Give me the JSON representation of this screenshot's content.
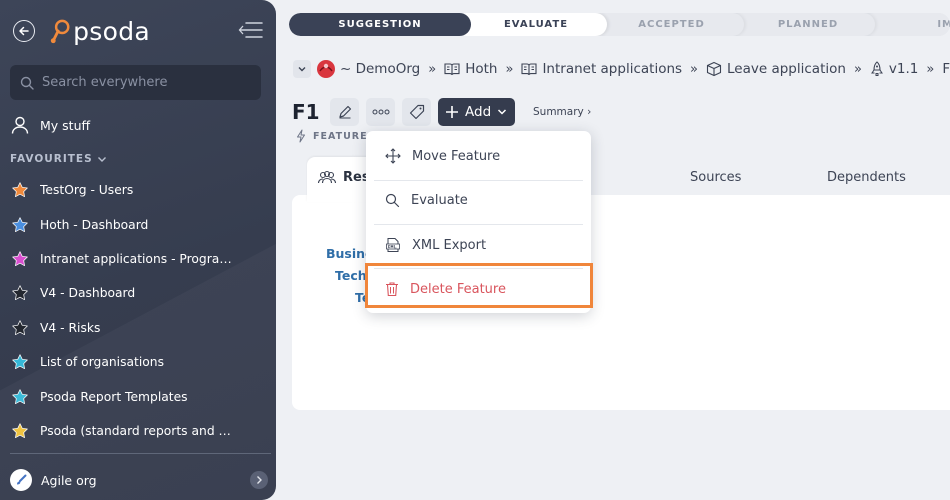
{
  "sidebar": {
    "app_name": "psoda",
    "search_placeholder": "Search everywhere",
    "my_stuff": "My stuff",
    "favourites_heading": "FAVOURITES",
    "favourites": [
      {
        "label": "TestOrg - Users",
        "color": "#f08a3c"
      },
      {
        "label": "Hoth - Dashboard",
        "color": "#4a8fe0"
      },
      {
        "label": "Intranet applications - Programme...",
        "color": "#d94fd0"
      },
      {
        "label": "V4 - Dashboard",
        "color": "#23272f"
      },
      {
        "label": "V4 - Risks",
        "color": "#23272f"
      },
      {
        "label": "List of organisations",
        "color": "#35b9d8"
      },
      {
        "label": "Psoda Report Templates",
        "color": "#35b9d8"
      },
      {
        "label": "Psoda (standard reports and work...",
        "color": "#f0c23c"
      }
    ],
    "org": "Agile org"
  },
  "stages": [
    "SUGGESTION",
    "EVALUATE",
    "ACCEPTED",
    "PLANNED",
    "IMPL"
  ],
  "breadcrumb": [
    {
      "label": "~ DemoOrg",
      "icon": "org-avatar-icon"
    },
    {
      "label": "Hoth",
      "icon": "book-icon"
    },
    {
      "label": "Intranet applications",
      "icon": "book-icon"
    },
    {
      "label": "Leave application",
      "icon": "box-icon"
    },
    {
      "label": "v1.1",
      "icon": "rocket-icon"
    },
    {
      "label": "F",
      "icon": ""
    }
  ],
  "page": {
    "title": "F1",
    "add_label": "Add",
    "summary_label": "Summary ›",
    "type_label": "FEATURE"
  },
  "tabs": {
    "active": "Res",
    "sources": "Sources",
    "dependents": "Dependents"
  },
  "side_links": [
    "Busine",
    "Tech",
    "Te"
  ],
  "menu": {
    "items": [
      {
        "label": "Move Feature",
        "icon": "move-icon"
      },
      {
        "label": "Evaluate",
        "icon": "search-icon"
      },
      {
        "label": "XML Export",
        "icon": "xml-icon"
      },
      {
        "label": "Delete Feature",
        "icon": "trash-icon"
      }
    ]
  },
  "colors": {
    "accent_dark": "#353c4e",
    "highlight": "#f0863b",
    "danger": "#d9555d",
    "link": "#2f6ea8"
  }
}
